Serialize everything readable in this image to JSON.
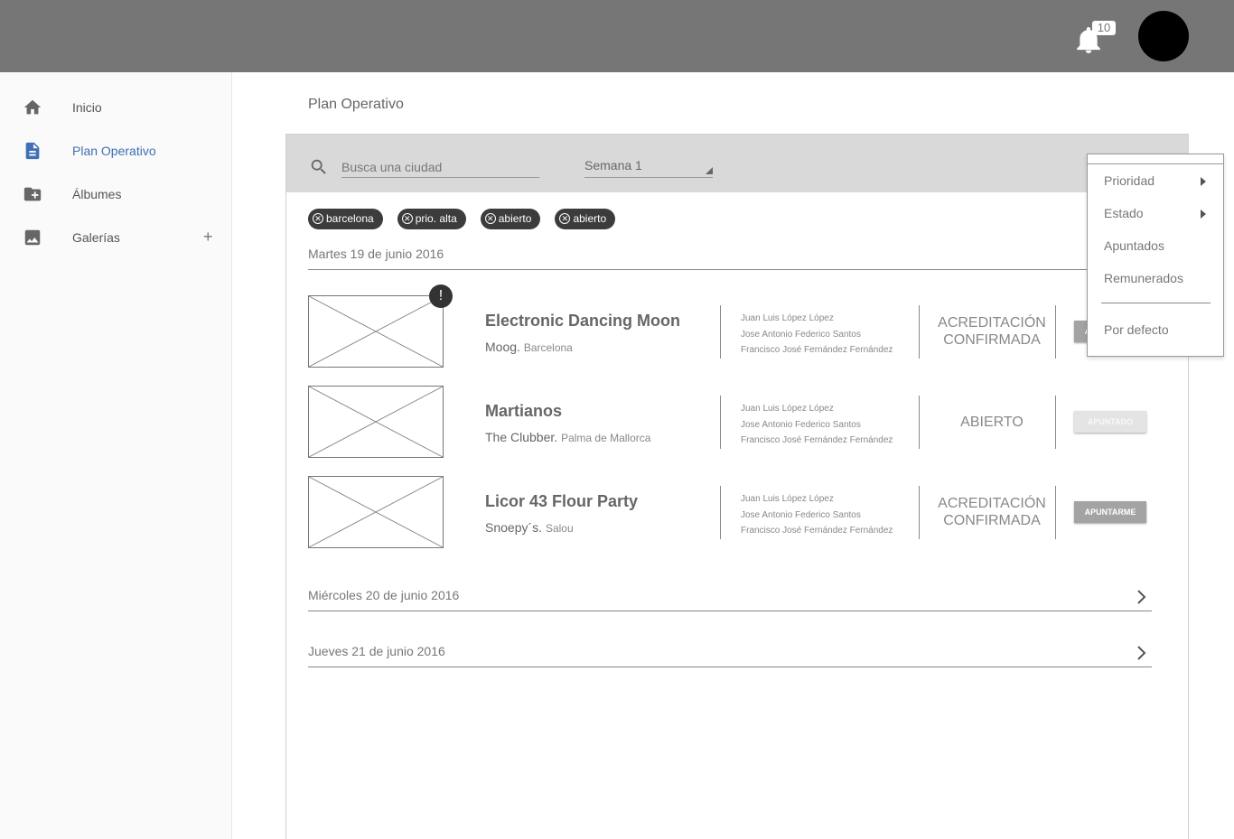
{
  "header": {
    "notification_count": "10"
  },
  "sidebar": {
    "items": [
      {
        "label": "Inicio",
        "icon": "home-icon"
      },
      {
        "label": "Plan Operativo",
        "icon": "document-icon"
      },
      {
        "label": "Álbumes",
        "icon": "folder-add-icon"
      },
      {
        "label": "Galerías",
        "icon": "image-icon"
      }
    ],
    "add_label": "+"
  },
  "main": {
    "title": "Plan Operativo",
    "search": {
      "placeholder": "Busca una ciudad",
      "value": ""
    },
    "week_select": {
      "value": "Semana 1"
    },
    "chips": [
      "barcelona",
      "prio. alta",
      "abierto",
      "abierto"
    ],
    "days": [
      {
        "label": "Martes 19 de junio 2016",
        "expanded": true,
        "events": [
          {
            "title": "Electronic Dancing Moon",
            "venue": "Moog",
            "city": "Barcelona",
            "people": [
              "Juan Luis López López",
              "Jose Antonio Federico Santos",
              "Francisco José Fernández Fernández"
            ],
            "status": "ACREDITACIÓN CONFIRMADA",
            "button": "APUNTARME",
            "alert": "!"
          },
          {
            "title": "Martianos",
            "venue": "The Clubber",
            "city": "Palma de Mallorca",
            "people": [
              "Juan Luis López López",
              "Jose Antonio Federico Santos",
              "Francisco José Fernández Fernández"
            ],
            "status": "ABIERTO",
            "button": "APUNTADO"
          },
          {
            "title": "Licor 43 Flour Party",
            "venue": "Snoepy´s",
            "city": "Salou",
            "people": [
              "Juan Luis López López",
              "Jose Antonio Federico Santos",
              "Francisco José Fernández Fernández"
            ],
            "status": "ACREDITACIÓN CONFIRMADA",
            "button": "APUNTARME"
          }
        ]
      },
      {
        "label": "Miércoles 20 de junio 2016",
        "expanded": false
      },
      {
        "label": "Jueves 21 de junio 2016",
        "expanded": false
      }
    ]
  },
  "menu": {
    "items": [
      "Prioridad",
      "Estado",
      "Apuntados",
      "Remunerados"
    ],
    "default_label": "Por defecto"
  },
  "colors": {
    "topbar": "#767676",
    "accent": "#3f6fb4",
    "chip": "#3c3c3c"
  }
}
